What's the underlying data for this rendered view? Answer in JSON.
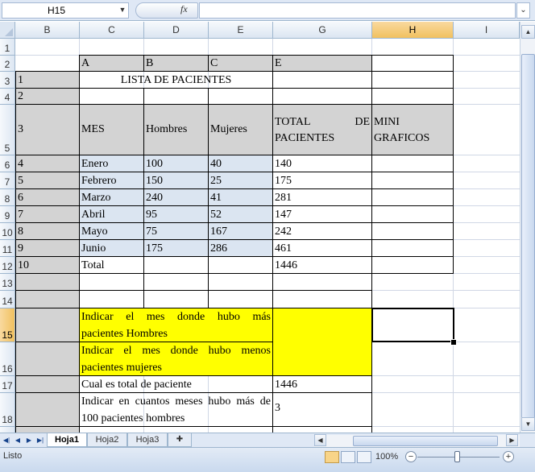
{
  "formula_bar": {
    "name_box": "H15",
    "name_box_arrow_icon": "dropdown-arrow",
    "fx_label": "fx",
    "formula_value": "",
    "expand_icon": "chevron-down"
  },
  "columns": [
    "B",
    "C",
    "D",
    "E",
    "G",
    "H",
    "I"
  ],
  "selected_column": "H",
  "rows": [
    "1",
    "2",
    "3",
    "4",
    "5",
    "6",
    "7",
    "8",
    "9",
    "10",
    "11",
    "12",
    "13",
    "14",
    "15",
    "16",
    "17",
    "18"
  ],
  "selected_row": "15",
  "sheet": {
    "header_letters": [
      "A",
      "B",
      "C",
      "E"
    ],
    "title": "LISTA DE PACIENTES",
    "row_numbers": [
      "1",
      "2",
      "3",
      "4",
      "5",
      "6",
      "7",
      "8",
      "9",
      "10"
    ],
    "table_headers": {
      "mes": "MES",
      "hombres": "Hombres",
      "mujeres": "Mujeres",
      "total_line1": "TOTAL",
      "total_line1b": "DE",
      "total_line2": "PACIENTES",
      "mini_line1": "MINI",
      "mini_line2": "GRAFICOS"
    },
    "months": [
      {
        "mes": "Enero",
        "hombres": "100",
        "mujeres": "40",
        "total": "140"
      },
      {
        "mes": "Febrero",
        "hombres": "150",
        "mujeres": "25",
        "total": "175"
      },
      {
        "mes": "Marzo",
        "hombres": "240",
        "mujeres": "41",
        "total": "281"
      },
      {
        "mes": "Abril",
        "hombres": "95",
        "mujeres": "52",
        "total": "147"
      },
      {
        "mes": "Mayo",
        "hombres": "75",
        "mujeres": "167",
        "total": "242"
      },
      {
        "mes": "Junio",
        "hombres": "175",
        "mujeres": "286",
        "total": "461"
      }
    ],
    "total_label": "Total",
    "grand_total": "1446",
    "questions": {
      "q1_line1": "Indicar el mes donde hubo más",
      "q1_line2": "pacientes Hombres",
      "q2_line1": "Indicar el mes donde hubo menos",
      "q2_line2": "pacientes mujeres",
      "q3": "Cual es total de paciente",
      "q3_answer": "1446",
      "q4_line1": "Indicar en cuantos meses hubo más de",
      "q4_line2": "100 pacientes hombres",
      "q4_answer": "3"
    }
  },
  "tabs": [
    "Hoja1",
    "Hoja2",
    "Hoja3"
  ],
  "active_tab": "Hoja1",
  "status": {
    "mode": "Listo",
    "zoom": "100%"
  },
  "colors": {
    "header_fill": "#d3d3d3",
    "data_fill": "#dbe5f1",
    "highlight_fill": "#ffff00",
    "selection_header": "#f1c15f"
  }
}
